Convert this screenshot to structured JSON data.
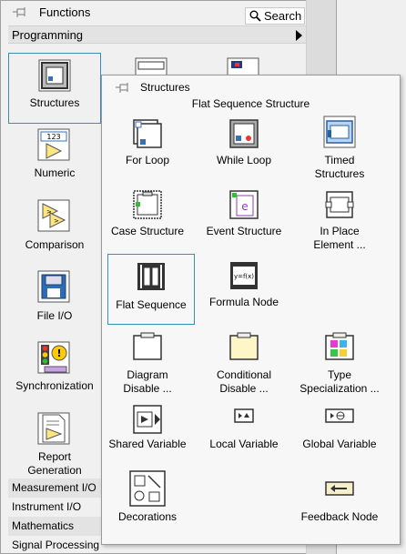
{
  "functions": {
    "title": "Functions",
    "search_label": "Search",
    "programming_label": "Programming",
    "items": [
      {
        "label": "Structures",
        "icon": "structures-icon"
      },
      {
        "label": "Numeric",
        "icon": "numeric-icon"
      },
      {
        "label": "Comparison",
        "icon": "comparison-icon"
      },
      {
        "label": "File I/O",
        "icon": "file-io-icon"
      },
      {
        "label": "Synchronization",
        "icon": "synchronization-icon"
      },
      {
        "label_line1": "Report",
        "label_line2": "Generation",
        "icon": "report-generation-icon"
      }
    ],
    "categories": [
      "Measurement I/O",
      "Instrument I/O",
      "Mathematics",
      "Signal Processing"
    ]
  },
  "structures": {
    "title": "Structures",
    "tooltip": "Flat Sequence Structure",
    "items": [
      {
        "line1": "For Loop",
        "line2": "",
        "icon": "for-loop-icon"
      },
      {
        "line1": "While Loop",
        "line2": "",
        "icon": "while-loop-icon"
      },
      {
        "line1": "Timed",
        "line2": "Structures",
        "icon": "timed-structures-icon"
      },
      {
        "line1": "Case Structure",
        "line2": "",
        "icon": "case-structure-icon"
      },
      {
        "line1": "Event Structure",
        "line2": "",
        "icon": "event-structure-icon"
      },
      {
        "line1": "In Place",
        "line2": "Element ...",
        "icon": "in-place-element-icon"
      },
      {
        "line1": "Flat Sequence",
        "line2": "",
        "icon": "flat-sequence-icon"
      },
      {
        "line1": "Formula Node",
        "line2": "",
        "icon": "formula-node-icon"
      },
      {
        "line1": "Diagram",
        "line2": "Disable ...",
        "icon": "diagram-disable-icon"
      },
      {
        "line1": "Conditional",
        "line2": "Disable ...",
        "icon": "conditional-disable-icon"
      },
      {
        "line1": "Type",
        "line2": "Specialization ...",
        "icon": "type-specialization-icon"
      },
      {
        "line1": "Shared Variable",
        "line2": "",
        "icon": "shared-variable-icon"
      },
      {
        "line1": "Local Variable",
        "line2": "",
        "icon": "local-variable-icon"
      },
      {
        "line1": "Global Variable",
        "line2": "",
        "icon": "global-variable-icon"
      },
      {
        "line1": "Decorations",
        "line2": "",
        "icon": "decorations-icon"
      },
      {
        "line1": "Feedback Node",
        "line2": "",
        "icon": "feedback-node-icon"
      }
    ],
    "formula_text": "y=f(x)",
    "numeric_text": "123"
  },
  "colors": {
    "selection_border": "#3a8fb5",
    "palette_bg": "#f0f0f0",
    "subpalette_bg": "#f7f7f7"
  }
}
